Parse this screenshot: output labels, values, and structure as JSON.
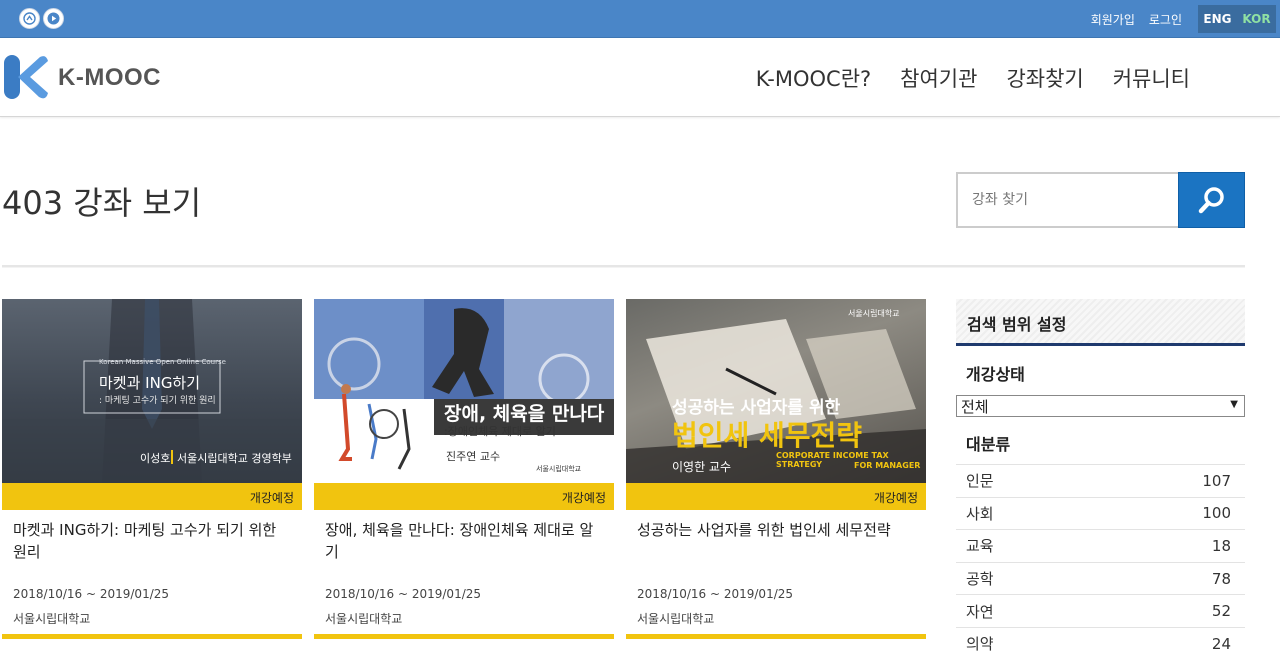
{
  "topbar": {
    "links": [
      "회원가입",
      "로그인"
    ],
    "lang": {
      "eng": "ENG",
      "kor": "KOR"
    }
  },
  "header": {
    "logo_text": "K-MOOC",
    "nav": [
      "K-MOOC란?",
      "참여기관",
      "강좌찾기",
      "커뮤니티"
    ]
  },
  "page": {
    "title": "403 강좌 보기",
    "search_placeholder": "강좌 찾기"
  },
  "courses": [
    {
      "thumb_top": "Korean Massive Open Online Course",
      "thumb_title": "마켓과 ING하기",
      "thumb_sub": ": 마케팅 고수가 되기 위한 원리",
      "thumb_prof": "이성호",
      "thumb_dept": "서울시립대학교 경영학부",
      "status": "개강예정",
      "title": "마켓과 ING하기: 마케팅 고수가 되기 위한 원리",
      "dates": "2018/10/16 ~ 2019/01/25",
      "institution": "서울시립대학교"
    },
    {
      "thumb_title": "장애, 체육을 만나다",
      "thumb_sub": ":장애인체육 제대로 알기",
      "thumb_prof": "진주연 교수",
      "thumb_logo": "서울시립대학교",
      "status": "개강예정",
      "title": "장애, 체육을 만나다: 장애인체육 제대로 알기",
      "dates": "2018/10/16 ~ 2019/01/25",
      "institution": "서울시립대학교"
    },
    {
      "thumb_logo": "서울시립대학교",
      "thumb_title1": "성공하는 사업자를 위한",
      "thumb_title2": "법인세 세무전략",
      "thumb_prof": "이영한 교수",
      "thumb_en1": "CORPORATE INCOME TAX STRATEGY",
      "thumb_en2": "FOR MANAGER",
      "status": "개강예정",
      "title": "성공하는 사업자를 위한 법인세 세무전략",
      "dates": "2018/10/16 ~ 2019/01/25",
      "institution": "서울시립대학교"
    }
  ],
  "sidebar": {
    "heading": "검색 범위 설정",
    "status_label": "개강상태",
    "status_selected": "전체",
    "category_label": "대분류",
    "categories": [
      {
        "name": "인문",
        "count": "107"
      },
      {
        "name": "사회",
        "count": "100"
      },
      {
        "name": "교육",
        "count": "18"
      },
      {
        "name": "공학",
        "count": "78"
      },
      {
        "name": "자연",
        "count": "52"
      },
      {
        "name": "의약",
        "count": "24"
      }
    ]
  },
  "colors": {
    "topbar": "#4a86c8",
    "accent": "#f1c40f",
    "button": "#1b74c2",
    "navy": "#1f3a6e"
  }
}
